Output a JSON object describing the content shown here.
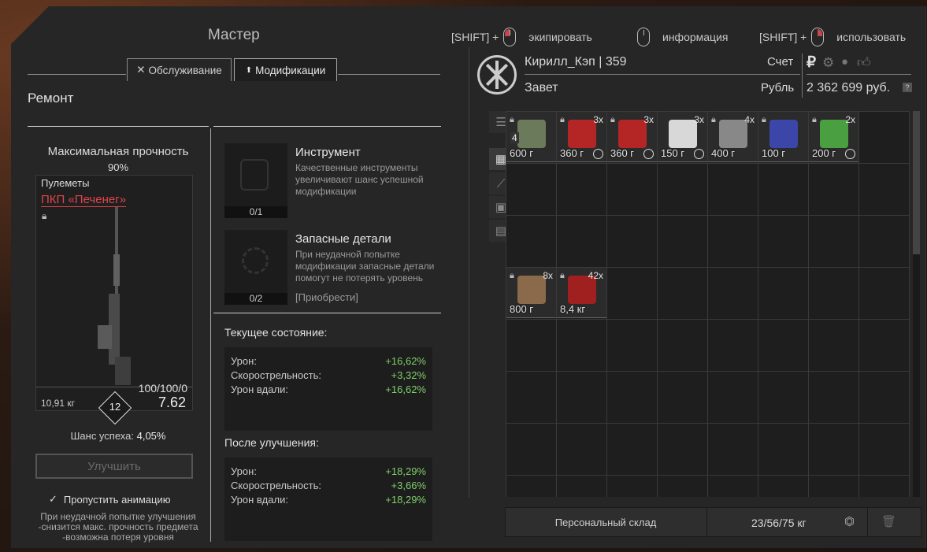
{
  "header": {
    "title": "Мастер",
    "hints": [
      {
        "prefix": "[SHIFT] +",
        "mouse": "left",
        "label": "экипировать"
      },
      {
        "prefix": "",
        "mouse": "none",
        "label": "информация"
      },
      {
        "prefix": "[SHIFT] +",
        "mouse": "right",
        "label": "использовать"
      }
    ]
  },
  "tabs": [
    {
      "icon": "wrench-icon",
      "label": "Обслуживание",
      "active": false
    },
    {
      "icon": "upgrade-icon",
      "label": "Модификации",
      "active": true
    }
  ],
  "repair": {
    "heading": "Ремонт",
    "max_durability_label": "Максимальная прочность",
    "max_durability_value": "90%",
    "weapon_category": "Пулеметы",
    "weapon_name": "ПКП «Печенег»",
    "weapon_weight": "10,91 кг",
    "weapon_level": "12",
    "weapon_durability": "100/100/0",
    "weapon_caliber": "7.62",
    "success_label": "Шанс успеха:",
    "success_value": "4,05%",
    "upgrade_button": "Улучшить",
    "skip_animation": "Пропустить анимацию",
    "skip_checked": true,
    "warning": [
      "При неудачной попытке улучшения",
      "-снизится макс. прочность предмета",
      "-возможна потеря уровня"
    ]
  },
  "modifiers": [
    {
      "title": "Инструмент",
      "desc": "Качественные инструменты увеличивают шанс успешной модификации",
      "count": "0/1",
      "extra": ""
    },
    {
      "title": "Запасные детали",
      "desc": "При неудачной попытке модификации запасные детали помогут не потерять уровень",
      "count": "0/2",
      "extra": "[Приобрести]"
    }
  ],
  "current_state": {
    "heading": "Текущее состояние:",
    "rows": [
      {
        "label": "Урон:",
        "value": "+16,62%"
      },
      {
        "label": "Скорострельность:",
        "value": "+3,32%"
      },
      {
        "label": "Урон вдали:",
        "value": "+16,62%"
      }
    ]
  },
  "after_upgrade": {
    "heading": "После улучшения:",
    "rows": [
      {
        "label": "Урон:",
        "value": "+18,29%"
      },
      {
        "label": "Скорострельность:",
        "value": "+3,66%"
      },
      {
        "label": "Урон вдали:",
        "value": "+18,29%"
      }
    ]
  },
  "player": {
    "name": "Кирилл_Кэп | 359",
    "faction": "Завет",
    "account_label": "Счет",
    "currency_label": "Рубль",
    "balance": "2 362 699 руб.",
    "help": "?"
  },
  "inventory": {
    "items": [
      {
        "name": "item-toolkit",
        "weight": "600 г",
        "count": "",
        "badge": "4",
        "lock": true,
        "timer": false,
        "color": "#6b7a5a"
      },
      {
        "name": "item-atlas-jar",
        "weight": "360 г",
        "count": "3x",
        "badge": "",
        "lock": true,
        "timer": true,
        "color": "#b42626"
      },
      {
        "name": "item-atlas-jar",
        "weight": "360 г",
        "count": "3x",
        "badge": "",
        "lock": true,
        "timer": true,
        "color": "#b42626"
      },
      {
        "name": "item-pills",
        "weight": "150 г",
        "count": "3x",
        "badge": "",
        "lock": false,
        "timer": true,
        "color": "#d8d8d8"
      },
      {
        "name": "item-syringe",
        "weight": "400 г",
        "count": "4x",
        "badge": "",
        "lock": true,
        "timer": false,
        "color": "#888888"
      },
      {
        "name": "item-battery",
        "weight": "100 г",
        "count": "",
        "badge": "",
        "lock": true,
        "timer": false,
        "color": "#3b46a8"
      },
      {
        "name": "item-medkit",
        "weight": "200 г",
        "count": "2x",
        "badge": "",
        "lock": true,
        "timer": true,
        "color": "#4aa040"
      },
      {
        "name": "item-crate",
        "weight": "800 г",
        "count": "8x",
        "badge": "",
        "lock": true,
        "timer": false,
        "color": "#8a6a4a"
      },
      {
        "name": "item-ammo-box",
        "weight": "8,4 кг",
        "count": "42x",
        "badge": "",
        "lock": true,
        "timer": false,
        "color": "#a02020"
      }
    ],
    "storage_label": "Персональный склад",
    "capacity": "23/56/75 кг"
  }
}
